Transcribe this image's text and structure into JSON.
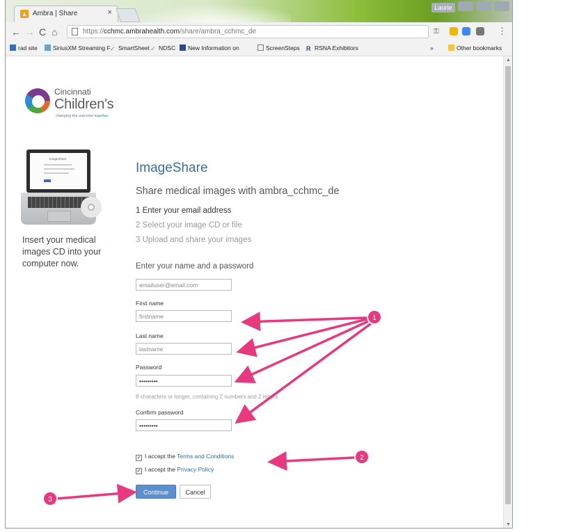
{
  "browser": {
    "tab_title": "Ambra | Share",
    "tab_close": "×",
    "user_chip": "Laurie",
    "url_prefix": "https://",
    "url_host": "cchmc.ambrahealth.com",
    "url_path": "/share/ambra_cchmc_de",
    "bookmarks": [
      "rad site",
      "SiriusXM Streaming F",
      "SmartSheet",
      "NDSC",
      "New Information on",
      "ScreenSteps",
      "RSNA Exhibitors"
    ],
    "bookmarks_more": "»",
    "other_bookmarks": "Other bookmarks"
  },
  "logo": {
    "line1": "Cincinnati",
    "line2": "Children's",
    "tagline": "changing the outcome together"
  },
  "laptop_screen": {
    "title": "ImageShare"
  },
  "sidebar": {
    "insert_text": "Insert your medical images CD into your computer now."
  },
  "page": {
    "title": "ImageShare",
    "subtitle": "Share medical images with ambra_cchmc_de",
    "steps": [
      "1 Enter your email address",
      "2 Select your image CD or file",
      "3 Upload and share your images"
    ],
    "form_heading": "Enter your name and a password"
  },
  "form": {
    "email_value": "emailuser@email.com",
    "first_name_label": "First name",
    "first_name_value": "firstname",
    "last_name_label": "Last name",
    "last_name_value": "lastname",
    "password_label": "Password",
    "password_value": "•••••••••",
    "password_hint": "8 characters or longer, containing 2 numbers and 2 letters",
    "confirm_label": "Confirm password",
    "confirm_value": "•••••••••",
    "terms_prefix": "I accept the ",
    "terms_link": "Terms and Conditions",
    "privacy_prefix": "I accept the ",
    "privacy_link": "Privacy Policy",
    "continue_label": "Continue",
    "cancel_label": "Cancel"
  },
  "annotations": {
    "marker1": "1",
    "marker2": "2",
    "marker3": "3",
    "color": "#e8387e"
  }
}
